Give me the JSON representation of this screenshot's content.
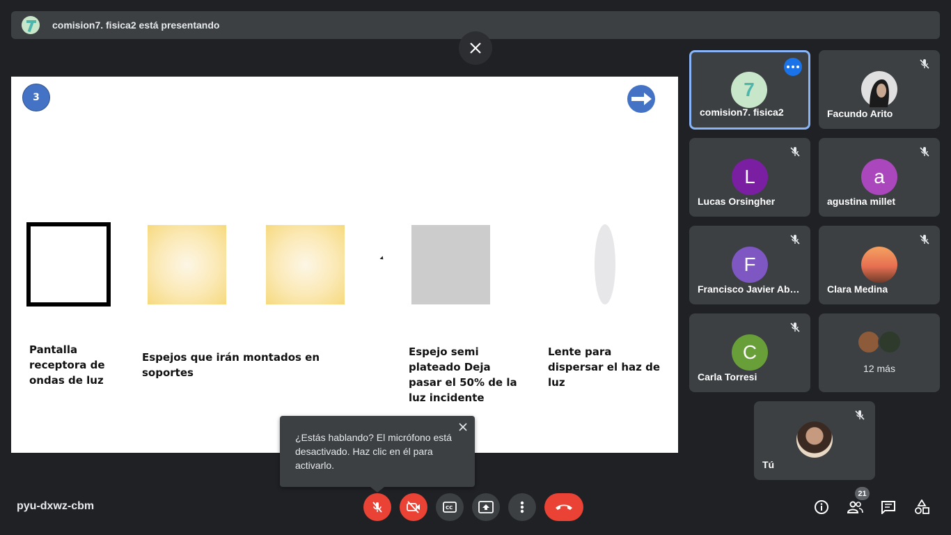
{
  "banner": {
    "text": "comision7. fisica2 está presentando"
  },
  "slide": {
    "number": "3",
    "captions": {
      "screen": "Pantalla receptora de ondas de luz",
      "mirrors": "Espejos que irán montados en soportes",
      "semi": "Espejo semi plateado Deja pasar el 50% de la luz incidente",
      "lens": "Lente para dispersar el haz de luz"
    }
  },
  "participants": [
    {
      "name": "comision7. fisica2",
      "avatar": "7",
      "color": "#c8e6c9",
      "muted": false,
      "active": true
    },
    {
      "name": "Facundo Arito",
      "avatar": "",
      "color": "#2b2b2b",
      "muted": true
    },
    {
      "name": "Lucas Orsingher",
      "avatar": "L",
      "color": "#7b1fa2",
      "muted": true
    },
    {
      "name": "agustina millet",
      "avatar": "a",
      "color": "#ab47bc",
      "muted": true
    },
    {
      "name": "Francisco Javier Abr…",
      "avatar": "F",
      "color": "#7e57c2",
      "muted": true
    },
    {
      "name": "Clara Medina",
      "avatar": "",
      "color": "#e07b39",
      "muted": true
    },
    {
      "name": "Carla Torresi",
      "avatar": "C",
      "color": "#689f38",
      "muted": true
    },
    {
      "name": "12 más",
      "avatar": "",
      "muted": false
    },
    {
      "name": "Tú",
      "avatar": "",
      "color": "#d7ccc8",
      "muted": true
    }
  ],
  "tooltip": {
    "text": "¿Estás hablando? El micrófono está desactivado. Haz clic en él para activarlo."
  },
  "meeting": {
    "code": "pyu-dxwz-cbm",
    "people_count": "21"
  },
  "controls": [
    "mic-off-icon",
    "camera-off-icon",
    "captions-icon",
    "present-icon",
    "more-options-icon",
    "hang-up-icon"
  ],
  "colors": {
    "background": "#202124",
    "panel": "#3c4043",
    "accent": "#8ab4f8",
    "danger": "#ea4335",
    "slide_accent": "#4472c4"
  }
}
